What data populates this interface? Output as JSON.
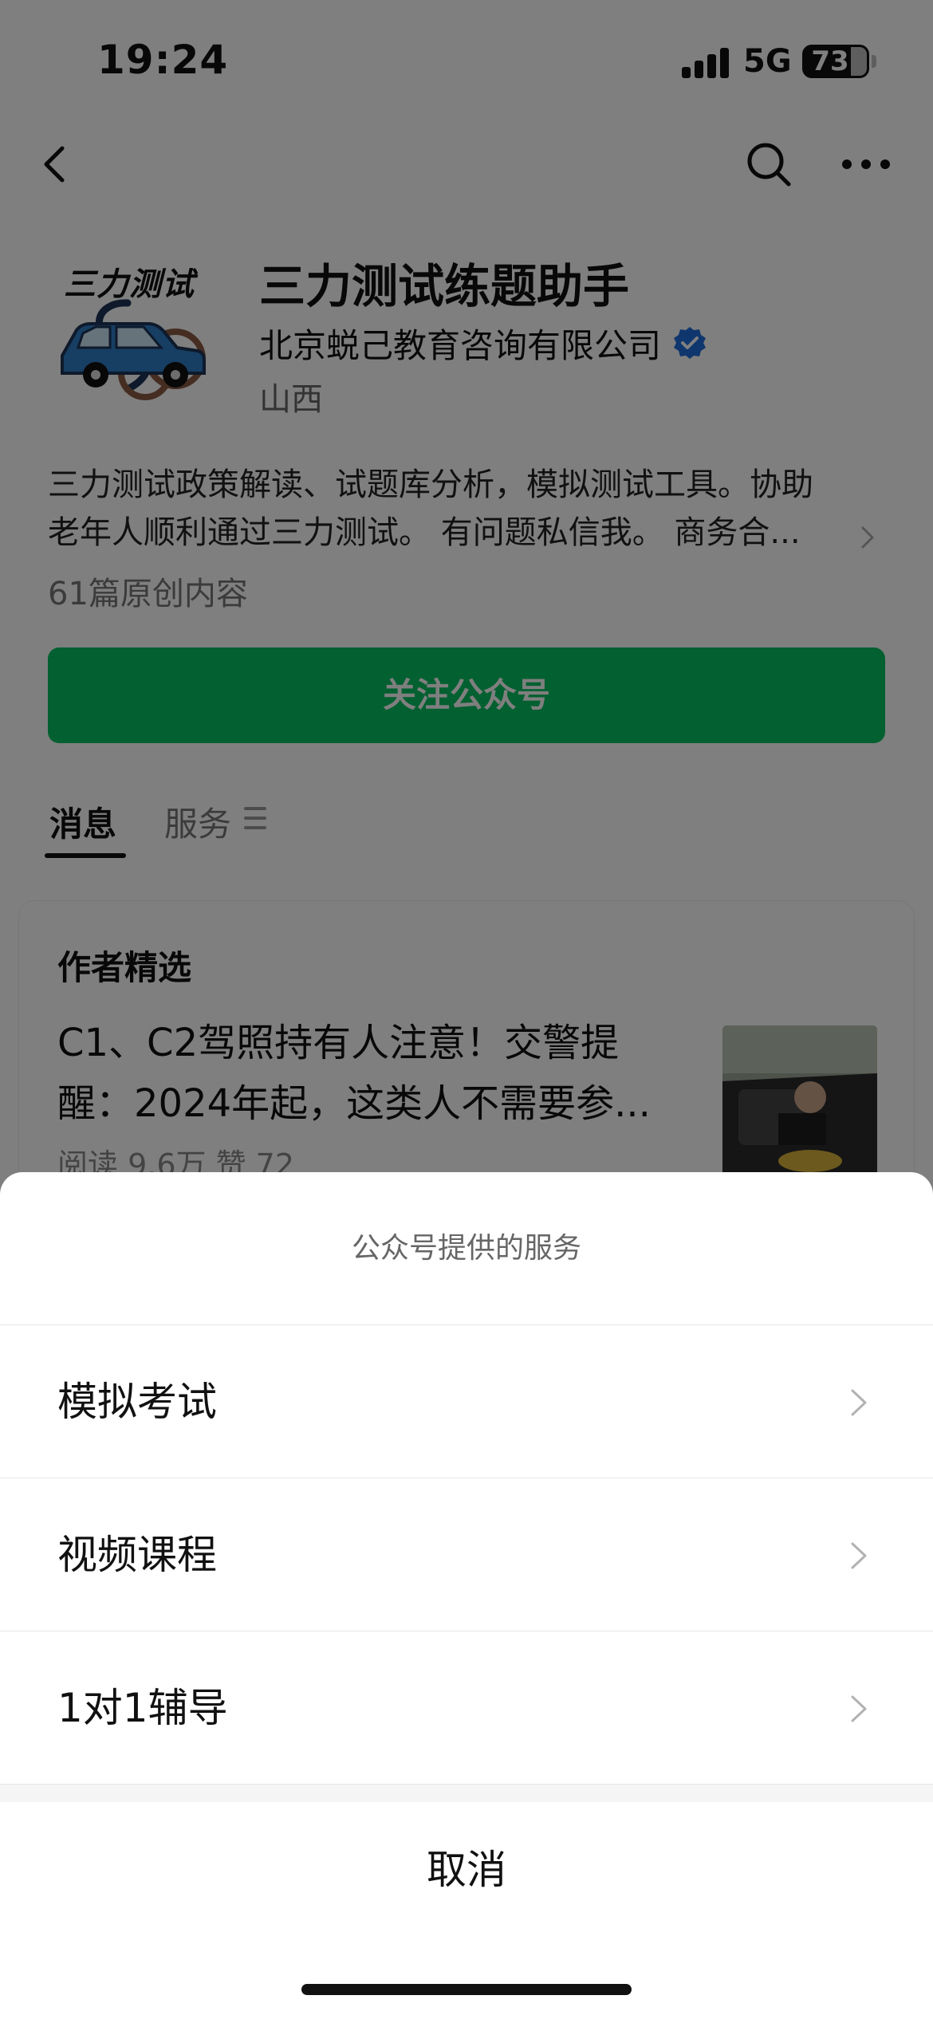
{
  "status_bar": {
    "time": "19:24",
    "network": "5G",
    "battery": "73"
  },
  "nav": {
    "back_icon": "chevron-left-icon",
    "search_icon": "search-icon",
    "more_icon": "more-dots-icon"
  },
  "profile": {
    "logo_text": "三力测试",
    "name": "三力测试练题助手",
    "company": "北京蜕己教育咨询有限公司",
    "location": "山西",
    "description_line1": "三力测试政策解读、试题库分析，模拟测试工具。协助",
    "description_line2": "老年人顺利通过三力测试。 有问题私信我。 商务合...",
    "original_count": "61篇原创内容",
    "follow_label": "关注公众号"
  },
  "tabs": [
    {
      "label": "消息"
    },
    {
      "label": "服务"
    }
  ],
  "feed": {
    "section_title": "作者精选",
    "article": {
      "title_line1": "C1、C2驾照持有人注意！交警提",
      "title_line2": "醒：2024年起，这类人不需要参...",
      "meta": "阅读 9.6万  赞 72"
    }
  },
  "sheet": {
    "title": "公众号提供的服务",
    "items": [
      {
        "label": "模拟考试"
      },
      {
        "label": "视频课程"
      },
      {
        "label": "1对1辅导"
      }
    ],
    "cancel_label": "取消"
  },
  "colors": {
    "accent_green": "#07c160",
    "verified_blue": "#1f6fdc",
    "overlay": "rgba(0,0,0,0.5)"
  }
}
